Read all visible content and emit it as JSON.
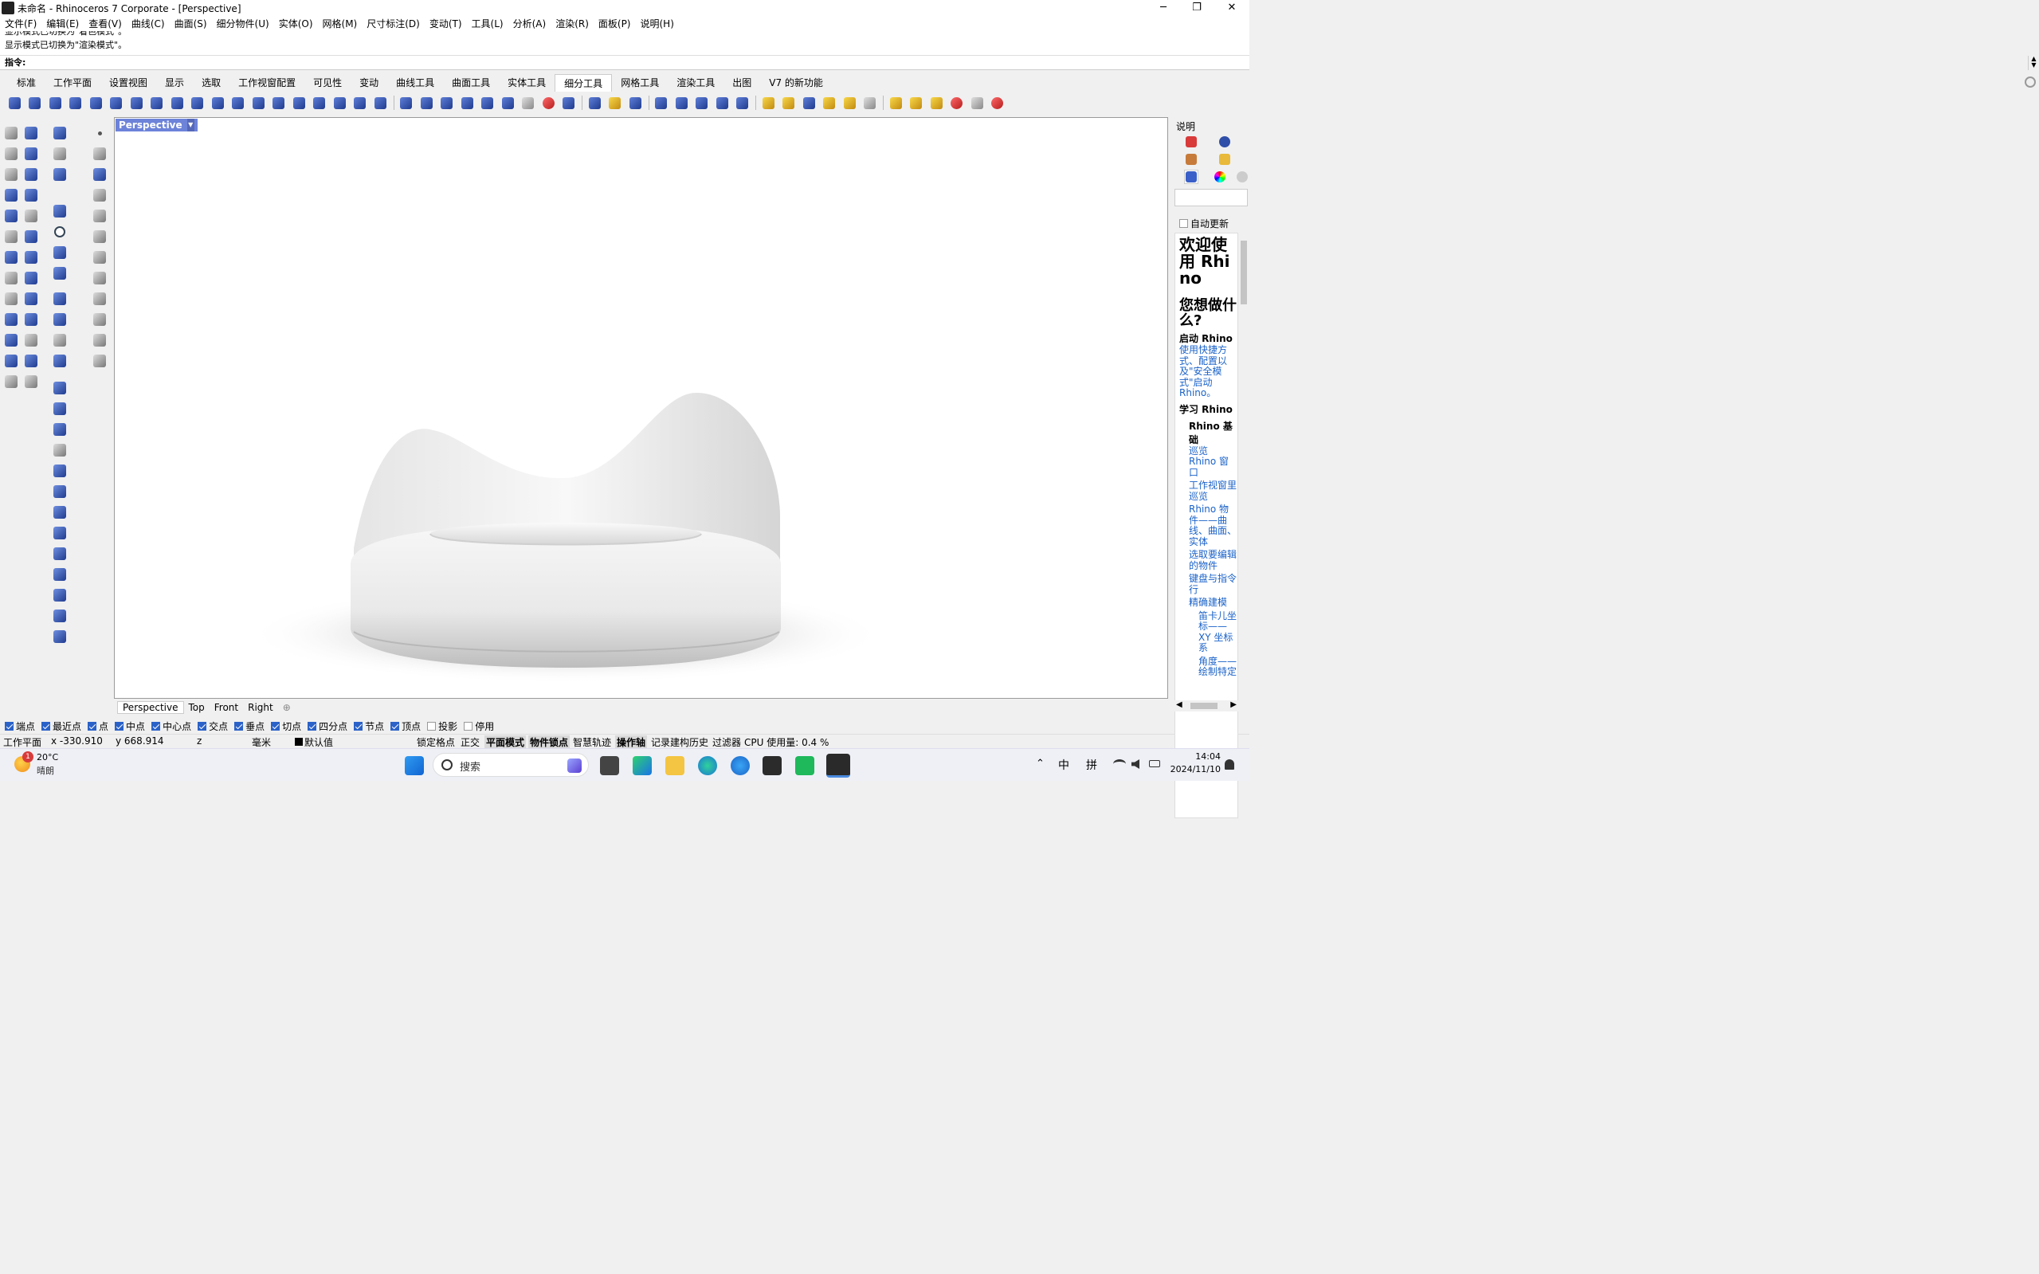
{
  "window": {
    "title": "未命名 - Rhinoceros 7 Corporate - [Perspective]",
    "minimize": "─",
    "maximize": "❐",
    "close": "✕"
  },
  "menu": [
    "文件(F)",
    "编辑(E)",
    "查看(V)",
    "曲线(C)",
    "曲面(S)",
    "细分物件(U)",
    "实体(O)",
    "网格(M)",
    "尺寸标注(D)",
    "变动(T)",
    "工具(L)",
    "分析(A)",
    "渲染(R)",
    "面板(P)",
    "说明(H)"
  ],
  "command": {
    "history_1": "显示模式已切换为\"着色模式\"。",
    "history_2": "显示模式已切换为\"渲染模式\"。",
    "prompt": "指令:"
  },
  "tabs": [
    "标准",
    "工作平面",
    "设置视图",
    "显示",
    "选取",
    "工作视窗配置",
    "可见性",
    "变动",
    "曲线工具",
    "曲面工具",
    "实体工具",
    "细分工具",
    "网格工具",
    "渲染工具",
    "出图",
    "V7 的新功能"
  ],
  "active_tab": "细分工具",
  "viewport": {
    "label": "Perspective",
    "tabs": [
      "Perspective",
      "Top",
      "Front",
      "Right"
    ],
    "add_tab": "⊕"
  },
  "osnaps": [
    {
      "label": "端点",
      "on": true
    },
    {
      "label": "最近点",
      "on": true
    },
    {
      "label": "点",
      "on": true
    },
    {
      "label": "中点",
      "on": true
    },
    {
      "label": "中心点",
      "on": true
    },
    {
      "label": "交点",
      "on": true
    },
    {
      "label": "垂点",
      "on": true
    },
    {
      "label": "切点",
      "on": true
    },
    {
      "label": "四分点",
      "on": true
    },
    {
      "label": "节点",
      "on": true
    },
    {
      "label": "顶点",
      "on": true
    },
    {
      "label": "投影",
      "on": false
    },
    {
      "label": "停用",
      "on": false
    }
  ],
  "status": {
    "cplane": "工作平面",
    "x": "x -330.910",
    "y": "y 668.914",
    "z": "z",
    "units": "毫米",
    "layer": "默认值",
    "grid_snap": "锁定格点",
    "ortho": "正交",
    "planar": "平面模式",
    "osnap": "物件锁点",
    "smarttrack": "智慧轨迹",
    "gumball": "操作轴",
    "history": "记录建构历史",
    "filter": "过滤器",
    "cpu": "CPU 使用量: 0.4 %"
  },
  "help_panel": {
    "header": "说明",
    "auto_update": "自动更新",
    "welcome": "欢迎使用 Rhino",
    "what_do": "您想做什么?",
    "start": "启动 Rhino",
    "start_link": "使用快捷方式、配置以及\"安全模式\"启动 Rhino。",
    "learn": "学习 Rhino",
    "basics": "Rhino 基础",
    "links": [
      "巡览 Rhino 窗口",
      "工作视窗里巡览",
      "Rhino 物件——曲线、曲面、实体",
      "选取要编辑的物件",
      "键盘与指令行"
    ],
    "precise": "精确建模",
    "sublinks": [
      "笛卡儿坐标——XY 坐标系",
      "角度——绘制特定"
    ]
  },
  "taskbar": {
    "weather_temp": "20°C",
    "weather_desc": "晴朗",
    "weather_badge": "1",
    "search": "搜索",
    "ime_1": "中",
    "ime_2": "拼",
    "time": "14:04",
    "date": "2024/11/10"
  }
}
